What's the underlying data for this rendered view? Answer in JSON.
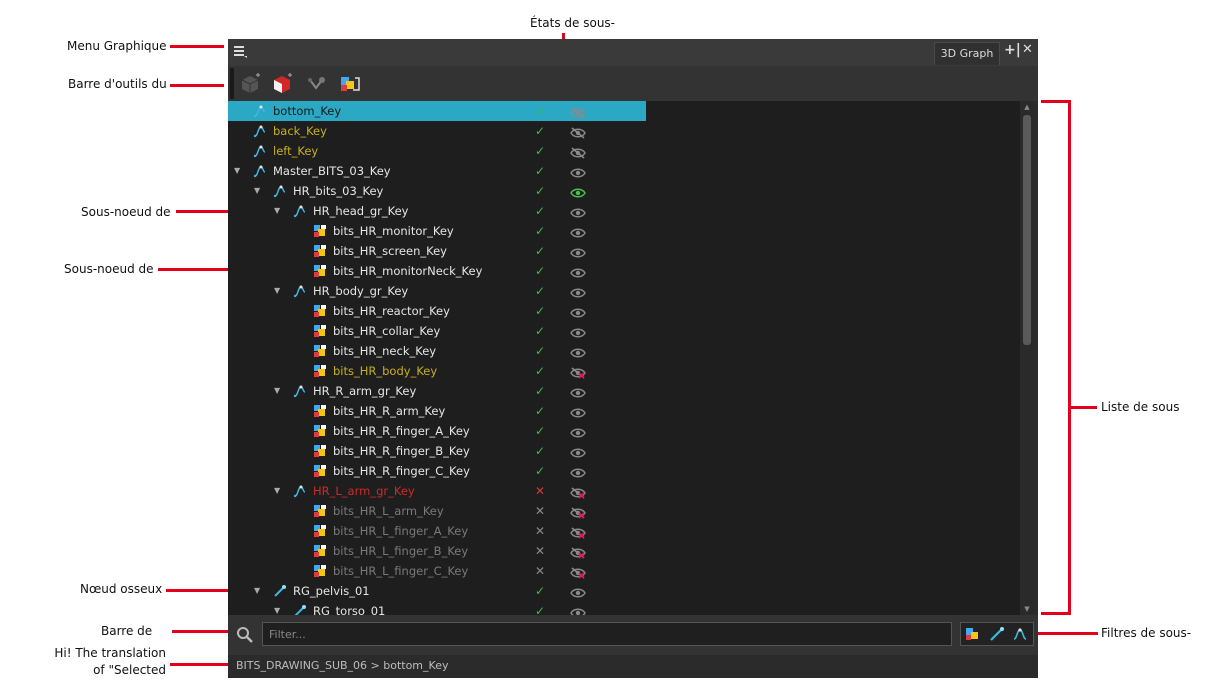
{
  "annotations": {
    "menu": "Menu Graphique",
    "toolbar": "Barre d'outils du",
    "subnode_states": "États de sous-",
    "subnode_of_1": "Sous-noeud de",
    "subnode_of_2": "Sous-noeud de",
    "bone_node": "Nœud osseux",
    "search_bar": "Barre de",
    "selected_1": "Hi! The translation",
    "selected_2": "of \"Selected",
    "subnode_list": "Liste de sous",
    "subnode_filters": "Filtres de sous-"
  },
  "window": {
    "tab_label": "3D Graph",
    "add_symbol": "+|",
    "close_symbol": "✕"
  },
  "filter": {
    "placeholder": "Filter...",
    "value": ""
  },
  "path": "BITS_DRAWING_SUB_06 > bottom_Key",
  "colors": {
    "selected": "#2aa8c4",
    "hidden_text": "#c8b020",
    "disabled_text": "#cc2b2b",
    "inactive_text": "#7a7a7a",
    "check": "#41b94a",
    "cross": "#d93636",
    "visible_eye": "#4bbf54",
    "hidden_eye_red": "#e0195c",
    "normal_text": "#e6e6e6"
  },
  "rows": [
    {
      "label": "bottom_Key",
      "depth": 0,
      "expander": false,
      "icon": "transform-key-icon",
      "text": "normal",
      "check": "✓",
      "eye": "hidden",
      "selected": true
    },
    {
      "label": "back_Key",
      "depth": 0,
      "expander": false,
      "icon": "transform-key-icon",
      "text": "hidden",
      "check": "✓",
      "eye": "hidden"
    },
    {
      "label": "left_Key",
      "depth": 0,
      "expander": false,
      "icon": "transform-key-icon",
      "text": "hidden",
      "check": "✓",
      "eye": "hidden"
    },
    {
      "label": "Master_BITS_03_Key",
      "depth": 0,
      "expander": true,
      "icon": "transform-key-icon",
      "text": "normal",
      "check": "✓",
      "eye": "visible"
    },
    {
      "label": "HR_bits_03_Key",
      "depth": 1,
      "expander": true,
      "icon": "transform-key-icon",
      "text": "normal",
      "check": "✓",
      "eye": "visible-green"
    },
    {
      "label": "HR_head_gr_Key",
      "depth": 2,
      "expander": true,
      "icon": "transform-key-icon",
      "text": "normal",
      "check": "✓",
      "eye": "visible"
    },
    {
      "label": "bits_HR_monitor_Key",
      "depth": 3,
      "expander": false,
      "icon": "mesh-icon",
      "text": "normal",
      "check": "✓",
      "eye": "visible"
    },
    {
      "label": "bits_HR_screen_Key",
      "depth": 3,
      "expander": false,
      "icon": "mesh-icon",
      "text": "normal",
      "check": "✓",
      "eye": "visible"
    },
    {
      "label": "bits_HR_monitorNeck_Key",
      "depth": 3,
      "expander": false,
      "icon": "mesh-icon",
      "text": "normal",
      "check": "✓",
      "eye": "visible"
    },
    {
      "label": "HR_body_gr_Key",
      "depth": 2,
      "expander": true,
      "icon": "transform-key-icon",
      "text": "normal",
      "check": "✓",
      "eye": "visible"
    },
    {
      "label": "bits_HR_reactor_Key",
      "depth": 3,
      "expander": false,
      "icon": "mesh-icon",
      "text": "normal",
      "check": "✓",
      "eye": "visible"
    },
    {
      "label": "bits_HR_collar_Key",
      "depth": 3,
      "expander": false,
      "icon": "mesh-icon",
      "text": "normal",
      "check": "✓",
      "eye": "visible"
    },
    {
      "label": "bits_HR_neck_Key",
      "depth": 3,
      "expander": false,
      "icon": "mesh-icon",
      "text": "normal",
      "check": "✓",
      "eye": "visible"
    },
    {
      "label": "bits_HR_body_Key",
      "depth": 3,
      "expander": false,
      "icon": "mesh-icon",
      "text": "hidden",
      "check": "✓",
      "eye": "hidden-red"
    },
    {
      "label": "HR_R_arm_gr_Key",
      "depth": 2,
      "expander": true,
      "icon": "transform-key-icon",
      "text": "normal",
      "check": "✓",
      "eye": "visible"
    },
    {
      "label": "bits_HR_R_arm_Key",
      "depth": 3,
      "expander": false,
      "icon": "mesh-icon",
      "text": "normal",
      "check": "✓",
      "eye": "visible"
    },
    {
      "label": "bits_HR_R_finger_A_Key",
      "depth": 3,
      "expander": false,
      "icon": "mesh-icon",
      "text": "normal",
      "check": "✓",
      "eye": "visible"
    },
    {
      "label": "bits_HR_R_finger_B_Key",
      "depth": 3,
      "expander": false,
      "icon": "mesh-icon",
      "text": "normal",
      "check": "✓",
      "eye": "visible"
    },
    {
      "label": "bits_HR_R_finger_C_Key",
      "depth": 3,
      "expander": false,
      "icon": "mesh-icon",
      "text": "normal",
      "check": "✓",
      "eye": "visible"
    },
    {
      "label": "HR_L_arm_gr_Key",
      "depth": 2,
      "expander": true,
      "icon": "transform-key-icon",
      "text": "disabled",
      "check": "✕",
      "eye": "hidden-red"
    },
    {
      "label": "bits_HR_L_arm_Key",
      "depth": 3,
      "expander": false,
      "icon": "mesh-icon",
      "text": "inactive",
      "check": "✕",
      "eye": "hidden-red"
    },
    {
      "label": "bits_HR_L_finger_A_Key",
      "depth": 3,
      "expander": false,
      "icon": "mesh-icon",
      "text": "inactive",
      "check": "✕",
      "eye": "hidden-red"
    },
    {
      "label": "bits_HR_L_finger_B_Key",
      "depth": 3,
      "expander": false,
      "icon": "mesh-icon",
      "text": "inactive",
      "check": "✕",
      "eye": "hidden-red"
    },
    {
      "label": "bits_HR_L_finger_C_Key",
      "depth": 3,
      "expander": false,
      "icon": "mesh-icon",
      "text": "inactive",
      "check": "✕",
      "eye": "hidden-red"
    },
    {
      "label": "RG_pelvis_01",
      "depth": 1,
      "expander": true,
      "icon": "bone-icon",
      "text": "normal",
      "check": "✓",
      "eye": "visible"
    },
    {
      "label": "RG_torso_01",
      "depth": 2,
      "expander": true,
      "icon": "bone-icon",
      "text": "normal",
      "check": "✓",
      "eye": "visible"
    }
  ]
}
